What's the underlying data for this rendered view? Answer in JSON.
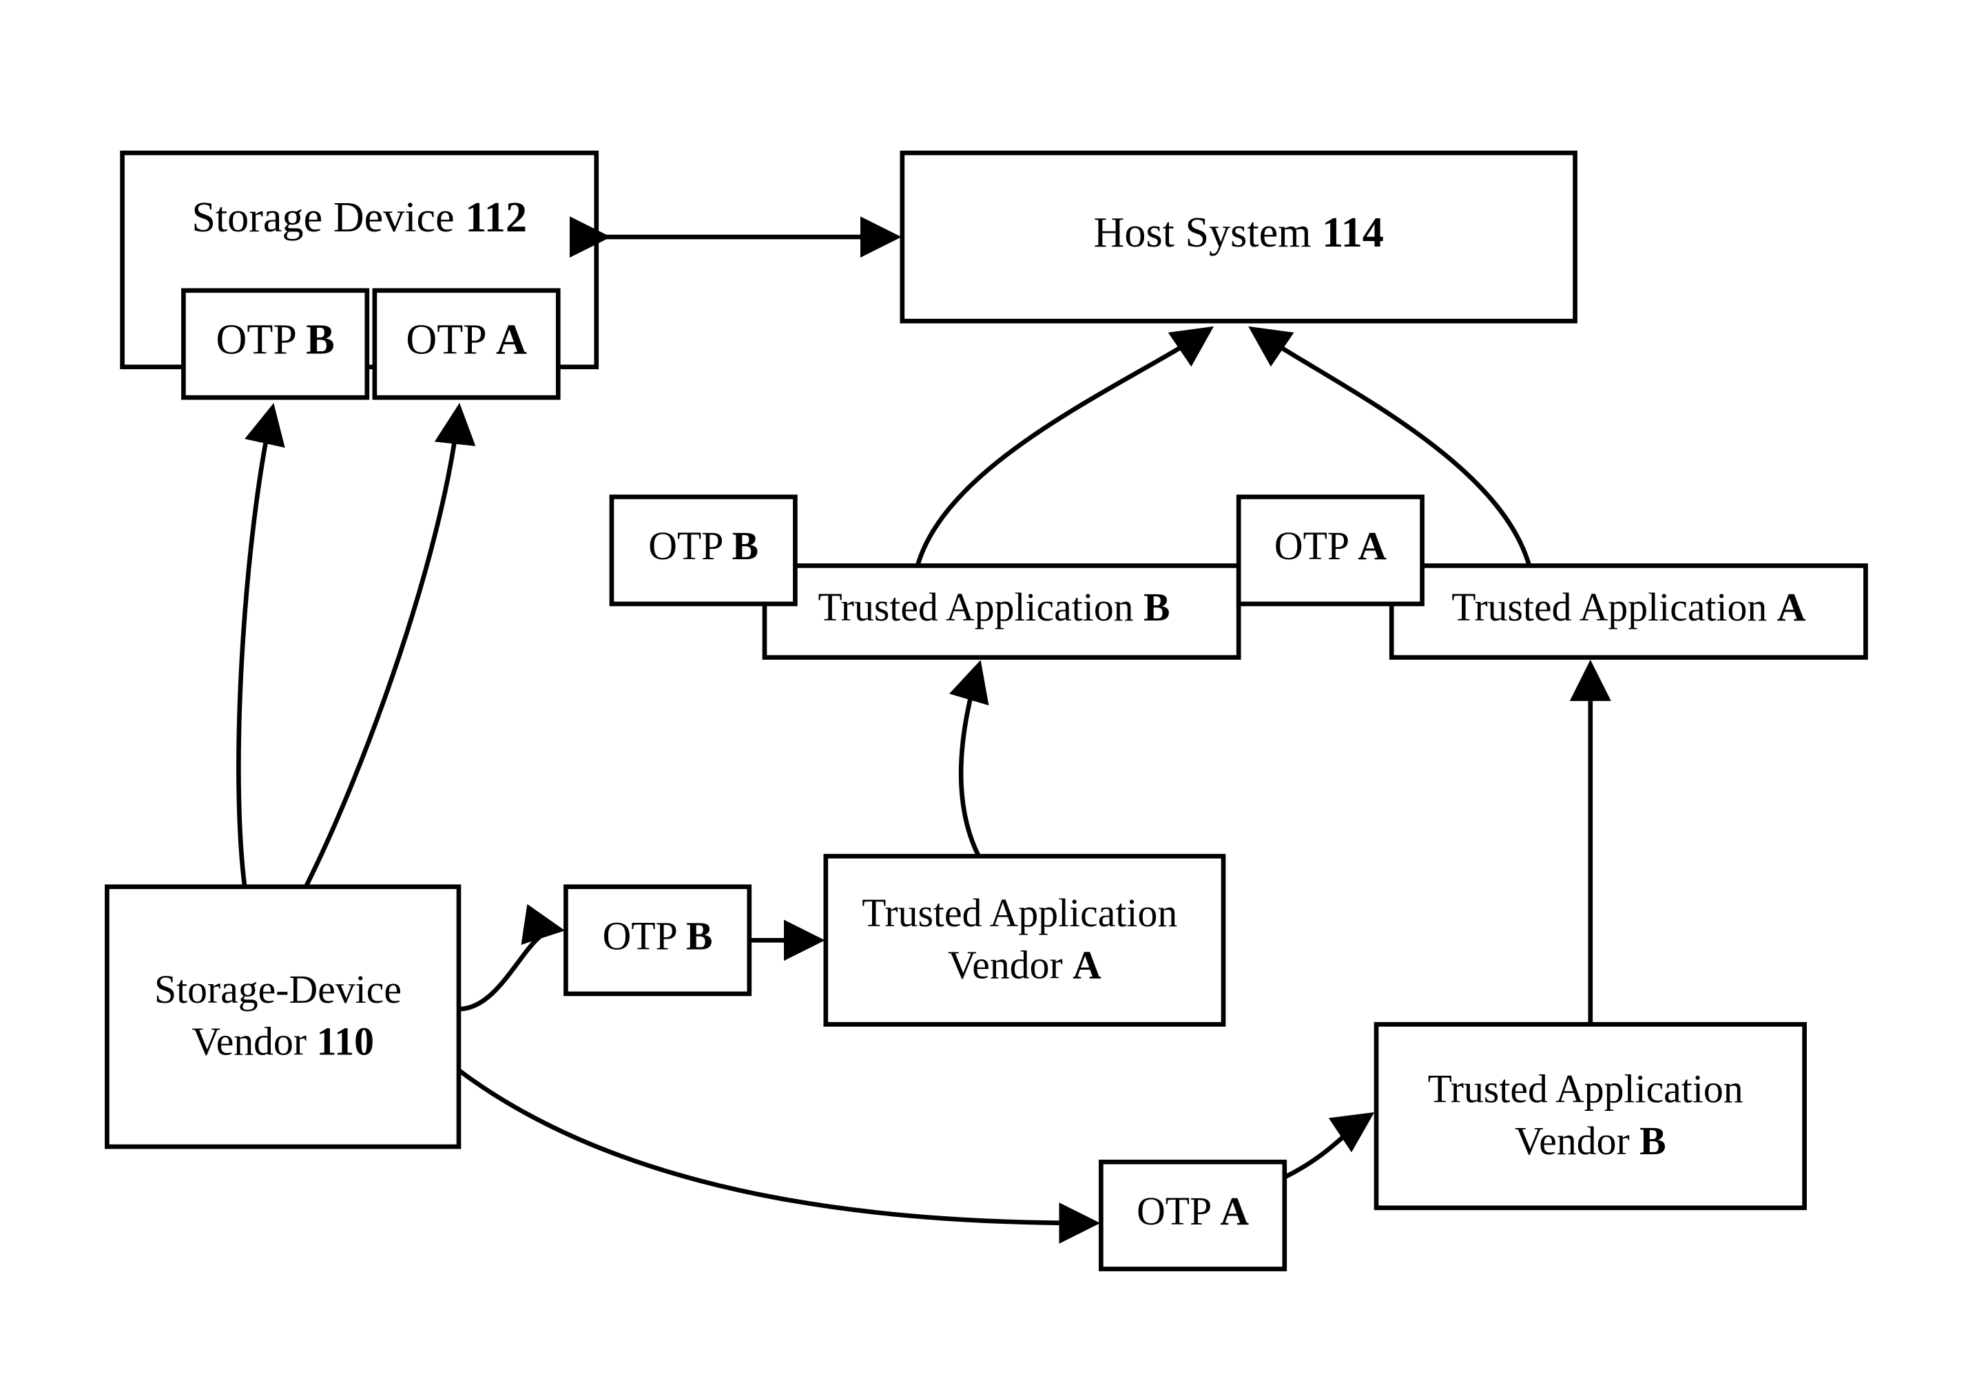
{
  "nodes": {
    "storage_device": {
      "label_prefix": "Storage Device ",
      "label_bold": "112"
    },
    "otp_b_sd": {
      "label_prefix": "OTP ",
      "label_bold": "B"
    },
    "otp_a_sd": {
      "label_prefix": "OTP ",
      "label_bold": "A"
    },
    "host_system": {
      "label_prefix": "Host System ",
      "label_bold": "114"
    },
    "trusted_app_b": {
      "label_prefix": "Trusted Application ",
      "label_bold": "B"
    },
    "otp_b_tab": {
      "label_prefix": "OTP ",
      "label_bold": "B"
    },
    "trusted_app_a": {
      "label_prefix": "Trusted Application ",
      "label_bold": "A"
    },
    "otp_a_taa": {
      "label_prefix": "OTP ",
      "label_bold": "A"
    },
    "storage_vendor": {
      "line1": "Storage-Device",
      "line2_prefix": "Vendor ",
      "line2_bold": "110"
    },
    "otp_b_mid": {
      "label_prefix": "OTP ",
      "label_bold": "B"
    },
    "ta_vendor_a": {
      "line1": "Trusted Application",
      "line2_prefix": "Vendor ",
      "line2_bold": "A"
    },
    "otp_a_mid": {
      "label_prefix": "OTP ",
      "label_bold": "A"
    },
    "ta_vendor_b": {
      "line1": "Trusted Application",
      "line2_prefix": "Vendor ",
      "line2_bold": "B"
    }
  }
}
